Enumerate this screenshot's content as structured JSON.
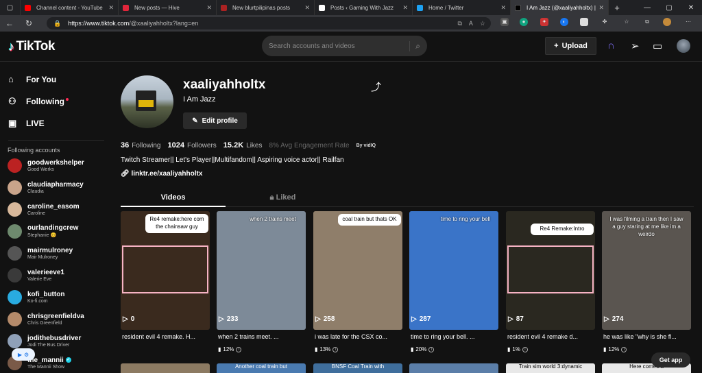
{
  "browser": {
    "tabs": [
      {
        "label": "Channel content - YouTube",
        "color": "#ff0000"
      },
      {
        "label": "New posts — Hive",
        "color": "#e2263b"
      },
      {
        "label": "New blurtpilipinas posts",
        "color": "#d33"
      },
      {
        "label": "Posts ‹ Gaming With Jazz",
        "color": "#ffffff"
      },
      {
        "label": "Home / Twitter",
        "color": "#1da1f2"
      },
      {
        "label": "I Am Jazz (@xaaliyahholtx) |",
        "color": "#000000"
      }
    ],
    "url_host": "https://www.tiktok.com",
    "url_path": "/@xaaliyahholtx?lang=en"
  },
  "header": {
    "logo": "TikTok",
    "search_placeholder": "Search accounts and videos",
    "upload_label": "Upload"
  },
  "sidebar": {
    "nav": [
      {
        "label": "For You",
        "icon": "home-icon"
      },
      {
        "label": "Following",
        "icon": "people-icon"
      },
      {
        "label": "LIVE",
        "icon": "live-icon"
      }
    ],
    "following_title": "Following accounts",
    "accounts": [
      {
        "username": "goodwerkshelper",
        "name": "Good Werks",
        "color": "#b22",
        "verified": false
      },
      {
        "username": "claudiapharmacy",
        "name": "Claudia",
        "color": "#c9a48a",
        "verified": false
      },
      {
        "username": "caroline_easom",
        "name": "Caroline",
        "color": "#d8b89b",
        "verified": false
      },
      {
        "username": "ourlandingcrew",
        "name": "Stephanie 😊",
        "color": "#6e8a6e",
        "verified": false
      },
      {
        "username": "mairmulroney",
        "name": "Mair Mulroney",
        "color": "#555",
        "verified": false
      },
      {
        "username": "valerieeve1",
        "name": "Valerie Eve",
        "color": "#3a3a3a",
        "verified": false
      },
      {
        "username": "kofi_button",
        "name": "Ko-fi.com",
        "color": "#29abe0",
        "verified": false
      },
      {
        "username": "chrisgreenfieldva",
        "name": "Chris Greenfield",
        "color": "#b48a6a",
        "verified": false
      },
      {
        "username": "jodithebusdriver",
        "name": "Jodi The Bus Driver",
        "color": "#8fa0b8",
        "verified": false
      },
      {
        "username": "the_mannii",
        "name": "The Mannii Show",
        "color": "#7a5a48",
        "verified": true
      }
    ]
  },
  "profile": {
    "username": "xaaliyahholtx",
    "display_name": "I Am Jazz",
    "edit_label": "Edit profile",
    "following_count": "36",
    "following_label": "Following",
    "followers_count": "1024",
    "followers_label": "Followers",
    "likes_count": "15.2K",
    "likes_label": "Likes",
    "engagement": "8% Avg Engagement Rate",
    "vidiq": "By vidIQ",
    "bio": "Twitch Streamer|| Let's Player||Multifandom|| Aspiring voice actor|| Railfan",
    "link": "linktr.ee/xaaliyahholtx",
    "tab_videos": "Videos",
    "tab_liked": "Liked"
  },
  "videos": [
    {
      "views": "0",
      "title": "resident evil 4 remake. H...",
      "engagement": "",
      "overlay": "Re4 remake:here com the chainsaw guy",
      "bg": "#3a2a1e"
    },
    {
      "views": "233",
      "title": "when 2 trains meet. ...",
      "engagement": "12%",
      "overlay": "when 2 trains meet",
      "bg": "#7d8a98"
    },
    {
      "views": "258",
      "title": "i was late for the CSX co...",
      "engagement": "13%",
      "overlay": "coal train but thats OK",
      "bg": "#8f7e6a"
    },
    {
      "views": "287",
      "title": "time to ring your bell. ...",
      "engagement": "20%",
      "overlay": "time to ring your bell",
      "bg": "#3a74c8"
    },
    {
      "views": "87",
      "title": "resident evil 4 remake d...",
      "engagement": "1%",
      "overlay": "Re4 Remake:Intro",
      "bg": "#2a2820"
    },
    {
      "views": "274",
      "title": "he was like \"why is she fl...",
      "engagement": "12%",
      "overlay": "I was filming a train then I saw a guy staring at me like im a weirdo",
      "bg": "#5a5550"
    }
  ],
  "bottom_row": [
    {
      "text": "",
      "bg": "#8c7a62"
    },
    {
      "text": "Another coal train but",
      "bg": "#4a7ab0"
    },
    {
      "text": "BNSF Coal Train with",
      "bg": "#3f6e9c"
    },
    {
      "text": "",
      "bg": "#5b7ea8"
    },
    {
      "text": "Train sim world 3:dynamic",
      "bg": "#e8e8e8"
    },
    {
      "text": "Here comes a",
      "bg": "#e8e8e8"
    }
  ],
  "get_app": "Get app"
}
